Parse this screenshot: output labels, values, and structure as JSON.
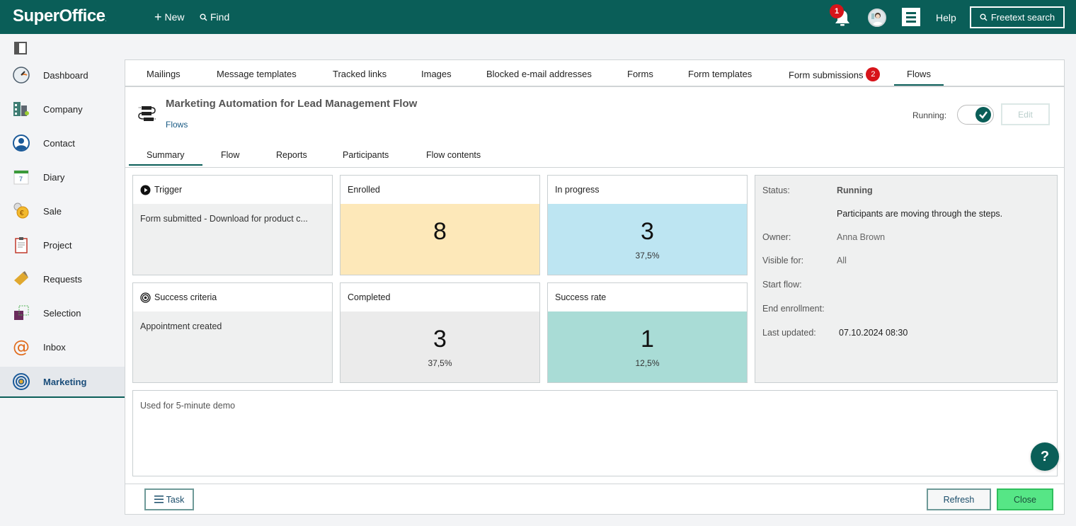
{
  "topbar": {
    "logo": "SuperOffice",
    "logo_mark": ".",
    "new_label": "New",
    "find_label": "Find",
    "notification_count": "1",
    "help_label": "Help",
    "freetext_label": "Freetext search",
    "brand_color": "#0a5e58"
  },
  "sidebar": {
    "items": [
      {
        "label": "Dashboard",
        "icon": "dashboard-gauge-icon"
      },
      {
        "label": "Company",
        "icon": "company-building-icon"
      },
      {
        "label": "Contact",
        "icon": "contact-person-icon"
      },
      {
        "label": "Diary",
        "icon": "diary-calendar-icon"
      },
      {
        "label": "Sale",
        "icon": "sale-coin-icon"
      },
      {
        "label": "Project",
        "icon": "project-clipboard-icon"
      },
      {
        "label": "Requests",
        "icon": "requests-ticket-icon"
      },
      {
        "label": "Selection",
        "icon": "selection-icon"
      },
      {
        "label": "Inbox",
        "icon": "inbox-at-icon"
      },
      {
        "label": "Marketing",
        "icon": "marketing-target-icon",
        "active": true
      }
    ]
  },
  "tabs": [
    {
      "label": "Mailings"
    },
    {
      "label": "Message templates"
    },
    {
      "label": "Tracked links"
    },
    {
      "label": "Images"
    },
    {
      "label": "Blocked e-mail addresses"
    },
    {
      "label": "Forms"
    },
    {
      "label": "Form templates"
    },
    {
      "label": "Form submissions",
      "badge": "2"
    },
    {
      "label": "Flows",
      "active": true
    }
  ],
  "flow": {
    "title": "Marketing Automation for Lead Management Flow",
    "subtitle": "Flows",
    "running_label": "Running:",
    "running": true,
    "edit_label": "Edit"
  },
  "subtabs": [
    {
      "label": "Summary",
      "active": true
    },
    {
      "label": "Flow"
    },
    {
      "label": "Reports"
    },
    {
      "label": "Participants"
    },
    {
      "label": "Flow contents"
    }
  ],
  "cards": {
    "trigger": {
      "title": "Trigger",
      "text": "Form submitted - Download for product c..."
    },
    "enrolled": {
      "title": "Enrolled",
      "value": "8",
      "color": "#fde8b9"
    },
    "in_progress": {
      "title": "In progress",
      "value": "3",
      "percent": "37,5%",
      "color": "#bde5f2"
    },
    "success_criteria": {
      "title": "Success criteria",
      "text": "Appointment created"
    },
    "completed": {
      "title": "Completed",
      "value": "3",
      "percent": "37,5%",
      "color": "#ebebeb"
    },
    "success_rate": {
      "title": "Success rate",
      "value": "1",
      "percent": "12,5%",
      "color": "#a9dcd6"
    }
  },
  "details": {
    "status_label": "Status:",
    "status_value": "Running",
    "status_description": "Participants are moving through the steps.",
    "owner_label": "Owner:",
    "owner_value": "Anna Brown",
    "visible_label": "Visible for:",
    "visible_value": "All",
    "start_label": "Start flow:",
    "start_value": "",
    "end_label": "End enrollment:",
    "end_value": "",
    "updated_label": "Last updated:",
    "updated_value": "07.10.2024 08:30"
  },
  "notes": "Used for 5-minute demo",
  "footer": {
    "task_label": "Task",
    "refresh_label": "Refresh",
    "close_label": "Close"
  },
  "help_fab": "?"
}
